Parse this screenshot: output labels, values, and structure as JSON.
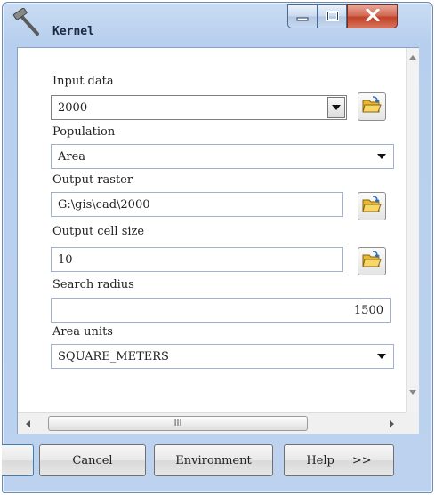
{
  "window": {
    "title": "Kernel",
    "icons": {
      "app": "hammer-icon",
      "minimize": "minimize-icon",
      "maximize": "maximize-icon",
      "close": "close-icon"
    }
  },
  "fields": {
    "input_data": {
      "label": "Input data",
      "value": "2000"
    },
    "population": {
      "label": "Population",
      "value": "Area"
    },
    "output_raster": {
      "label": "Output raster",
      "value": "G:\\gis\\cad\\2000"
    },
    "output_cell_size": {
      "label": "Output cell size",
      "value": "10"
    },
    "search_radius": {
      "label": "Search radius",
      "value": "1500"
    },
    "area_units": {
      "label": "Area units",
      "value": "SQUARE_METERS"
    }
  },
  "scroll": {
    "h_thumb_grip": "III"
  },
  "buttons": {
    "cancel": "Cancel",
    "environment": "Environment",
    "help": "Help",
    "help_arrows": ">>"
  },
  "colors": {
    "title_bar": "#bcd2ee",
    "close_button": "#c14228",
    "field_border": "#9fb3cf"
  }
}
